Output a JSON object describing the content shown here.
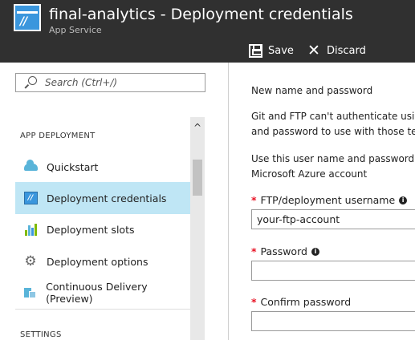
{
  "header": {
    "title": "final-analytics - Deployment credentials",
    "subtitle": "App Service",
    "app_icon": "app-service-icon",
    "commands": {
      "save_label": "Save",
      "save_icon": "save-icon",
      "discard_label": "Discard",
      "discard_icon": "close-icon"
    }
  },
  "sidebar": {
    "search_placeholder": "Search (Ctrl+/)",
    "section_app_deployment": "APP DEPLOYMENT",
    "section_settings": "SETTINGS",
    "items": [
      {
        "label": "Quickstart",
        "icon": "cloud-icon",
        "active": false
      },
      {
        "label": "Deployment credentials",
        "icon": "credentials-icon",
        "active": true
      },
      {
        "label": "Deployment slots",
        "icon": "slots-icon",
        "active": false
      },
      {
        "label": "Deployment options",
        "icon": "gear-icon",
        "active": false
      },
      {
        "label": "Continuous Delivery (Preview)",
        "icon": "continuous-delivery-icon",
        "active": false
      }
    ],
    "scroll_up": "^"
  },
  "form": {
    "heading": "New name and password",
    "para1_line1": "Git and FTP can't authenticate using",
    "para1_line2": "and password to use with those tec",
    "para2_line1": "Use this user name and password to",
    "para2_line2": "Microsoft Azure account",
    "required_mark": "*",
    "info_glyph": "i",
    "username_label": "FTP/deployment username",
    "username_value": "your-ftp-account",
    "password_label": "Password",
    "password_value": "",
    "confirm_label": "Confirm password",
    "confirm_value": ""
  },
  "colors": {
    "header_bg": "#303030",
    "active_item_bg": "#bfe6f5",
    "accent_blue": "#3a96dd",
    "required_red": "#e81123"
  }
}
